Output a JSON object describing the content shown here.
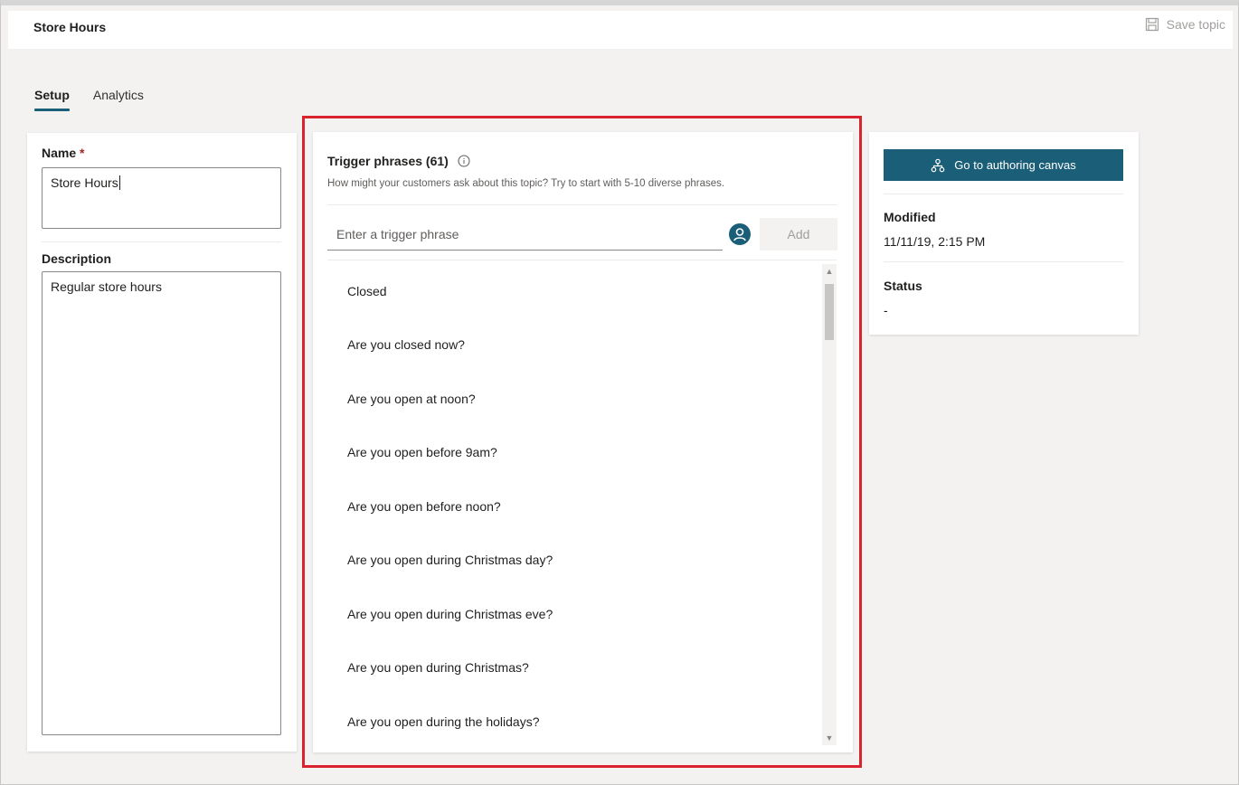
{
  "header": {
    "title": "Store Hours",
    "save_label": "Save topic"
  },
  "tabs": [
    {
      "label": "Setup",
      "active": true
    },
    {
      "label": "Analytics",
      "active": false
    }
  ],
  "details": {
    "name_label": "Name",
    "required_mark": "*",
    "name_value": "Store Hours",
    "description_label": "Description",
    "description_value": "Regular store hours"
  },
  "trigger": {
    "title": "Trigger phrases (61)",
    "subtitle": "How might your customers ask about this topic? Try to start with 5-10 diverse phrases.",
    "input_placeholder": "Enter a trigger phrase",
    "add_label": "Add",
    "phrases": [
      "Closed",
      "Are you closed now?",
      "Are you open at noon?",
      "Are you open before 9am?",
      "Are you open before noon?",
      "Are you open during Christmas day?",
      "Are you open during Christmas eve?",
      "Are you open during Christmas?",
      "Are you open during the holidays?"
    ]
  },
  "sidepanel": {
    "canvas_button_label": "Go to authoring canvas",
    "modified_label": "Modified",
    "modified_value": "11/11/19, 2:15 PM",
    "status_label": "Status",
    "status_value": "-"
  },
  "colors": {
    "accent": "#1b5e78",
    "highlight_border": "#d9232e",
    "required": "#a4262c"
  },
  "icons": {
    "save": "save-icon",
    "info": "info-icon",
    "avatar": "avatar-icon",
    "canvas": "org-chart-icon"
  }
}
